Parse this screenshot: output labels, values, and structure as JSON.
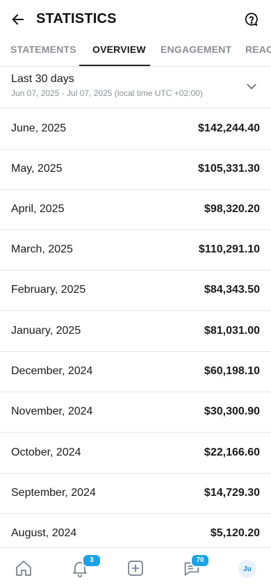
{
  "header": {
    "title": "STATISTICS",
    "back_icon": "arrow-left-icon",
    "help_icon": "help-circle-icon"
  },
  "tabs": [
    {
      "label": "STATEMENTS",
      "active": false
    },
    {
      "label": "OVERVIEW",
      "active": true
    },
    {
      "label": "ENGAGEMENT",
      "active": false
    },
    {
      "label": "REACH",
      "active": false
    }
  ],
  "period": {
    "title": "Last 30 days",
    "range": "Jun 07, 2025 - Jul 07, 2025 (local time UTC +02:00)",
    "icon": "chevron-down-icon"
  },
  "monthly": [
    {
      "month": "June, 2025",
      "amount": "$142,244.40"
    },
    {
      "month": "May, 2025",
      "amount": "$105,331.30"
    },
    {
      "month": "April, 2025",
      "amount": "$98,320.20"
    },
    {
      "month": "March, 2025",
      "amount": "$110,291.10"
    },
    {
      "month": "February, 2025",
      "amount": "$84,343.50"
    },
    {
      "month": "January, 2025",
      "amount": "$81,031.00"
    },
    {
      "month": "December, 2024",
      "amount": "$60,198.10"
    },
    {
      "month": "November, 2024",
      "amount": "$30,300.90"
    },
    {
      "month": "October, 2024",
      "amount": "$22,166.60"
    },
    {
      "month": "September, 2024",
      "amount": "$14,729.30"
    },
    {
      "month": "August, 2024",
      "amount": "$5,120.20"
    }
  ],
  "bottom_nav": {
    "home_icon": "home-icon",
    "notifications_icon": "bell-icon",
    "notifications_badge": "3",
    "create_icon": "plus-square-icon",
    "messages_icon": "message-icon",
    "messages_badge": "70",
    "avatar_initials": "Ju",
    "accent_color": "#1aa3e8"
  }
}
